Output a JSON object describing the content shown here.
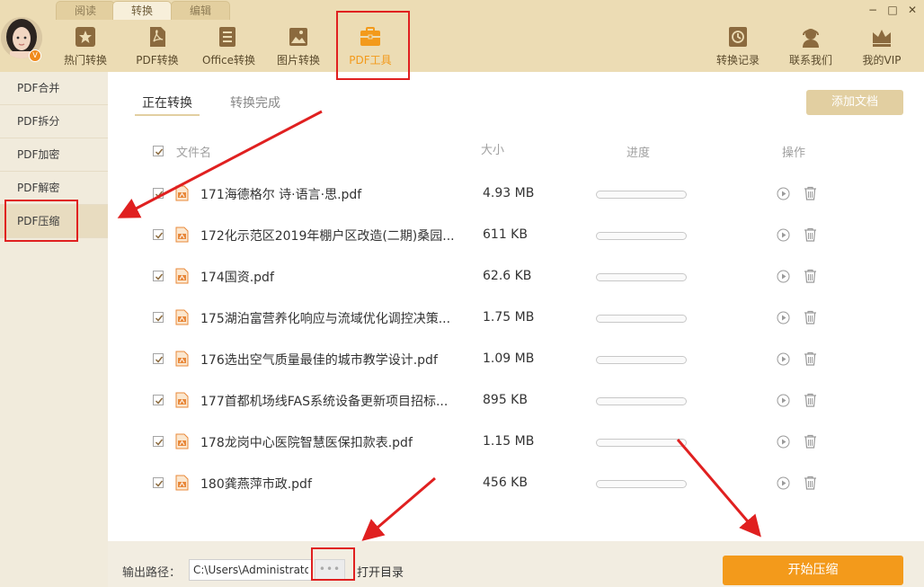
{
  "colors": {
    "accent": "#f39a1b",
    "topbar_bg": "#ecdcb4",
    "annotation_red": "#e02020",
    "add_button_bg": "#e2cfa1"
  },
  "window": {
    "tabs": [
      {
        "label": "阅读",
        "active": false
      },
      {
        "label": "转换",
        "active": true
      },
      {
        "label": "编辑",
        "active": false
      }
    ],
    "controls": {
      "minimize": "−",
      "maximize": "□",
      "close": "✕"
    }
  },
  "user": {
    "badge": "V",
    "avatar_icon": "avatar-icon"
  },
  "toolbar": {
    "left": [
      {
        "label": "热门转换",
        "icon": "star-icon"
      },
      {
        "label": "PDF转换",
        "icon": "pdf-icon"
      },
      {
        "label": "Office转换",
        "icon": "document-icon"
      },
      {
        "label": "图片转换",
        "icon": "image-icon"
      },
      {
        "label": "PDF工具",
        "icon": "toolbox-icon",
        "active": true
      }
    ],
    "right": [
      {
        "label": "转换记录",
        "icon": "history-icon"
      },
      {
        "label": "联系我们",
        "icon": "headset-icon"
      },
      {
        "label": "我的VIP",
        "icon": "crown-icon"
      }
    ]
  },
  "sidebar": {
    "items": [
      {
        "label": "PDF合并"
      },
      {
        "label": "PDF拆分"
      },
      {
        "label": "PDF加密"
      },
      {
        "label": "PDF解密"
      },
      {
        "label": "PDF压缩",
        "active": true
      }
    ]
  },
  "main": {
    "subtabs": [
      {
        "label": "正在转换",
        "active": true
      },
      {
        "label": "转换完成",
        "active": false
      }
    ],
    "add_button": "添加文档",
    "columns": {
      "name": "文件名",
      "size": "大小",
      "progress": "进度",
      "action": "操作"
    },
    "files": [
      {
        "name": "171海德格尔 诗·语言·思.pdf",
        "size": "4.93 MB",
        "checked": true,
        "progress": 0
      },
      {
        "name": "172化示范区2019年棚户区改造(二期)桑园...",
        "size": "611 KB",
        "checked": true,
        "progress": 0
      },
      {
        "name": "174国资.pdf",
        "size": "62.6 KB",
        "checked": true,
        "progress": 0
      },
      {
        "name": "175湖泊富营养化响应与流域优化调控决策...",
        "size": "1.75 MB",
        "checked": true,
        "progress": 0
      },
      {
        "name": "176选出空气质量最佳的城市教学设计.pdf",
        "size": "1.09 MB",
        "checked": true,
        "progress": 0
      },
      {
        "name": "177首都机场线FAS系统设备更新项目招标...",
        "size": "895 KB",
        "checked": true,
        "progress": 0
      },
      {
        "name": "178龙岗中心医院智慧医保扣款表.pdf",
        "size": "1.15 MB",
        "checked": true,
        "progress": 0
      },
      {
        "name": "180龚燕萍市政.pdf",
        "size": "456 KB",
        "checked": true,
        "progress": 0
      }
    ]
  },
  "bottom": {
    "output_label": "输出路径：",
    "output_path": "C:\\Users\\Administrator",
    "browse": "•••",
    "open_dir": "打开目录",
    "start_button": "开始压缩"
  }
}
